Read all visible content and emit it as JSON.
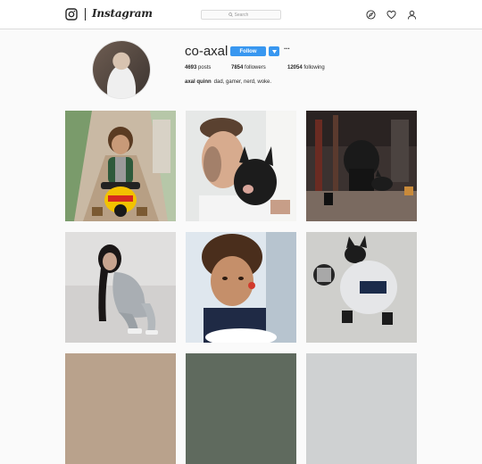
{
  "header": {
    "brand": "Instagram",
    "search_placeholder": "Search",
    "icons": [
      "instagram-icon",
      "compass-icon",
      "heart-icon",
      "person-icon"
    ]
  },
  "profile": {
    "username": "co-axal",
    "follow_label": "Follow",
    "more_label": "···",
    "posts_count": "4693",
    "posts_label": "posts",
    "followers_count": "7854",
    "followers_label": "followers",
    "following_count": "12054",
    "following_label": "following",
    "full_name": "axal quinn",
    "bio": "dad, gamer, nerd, woke."
  },
  "colors": {
    "accent": "#3897f0",
    "background": "#fafafa",
    "text": "#262626",
    "border": "#dbdbdb"
  },
  "posts": [
    "toddler-on-ride-on-toy",
    "man-kissing-french-bulldog",
    "dogs-in-dark-bar",
    "woman-in-silver-outfit-crouching",
    "child-eating-at-table",
    "dog-wearing-hoodie"
  ]
}
